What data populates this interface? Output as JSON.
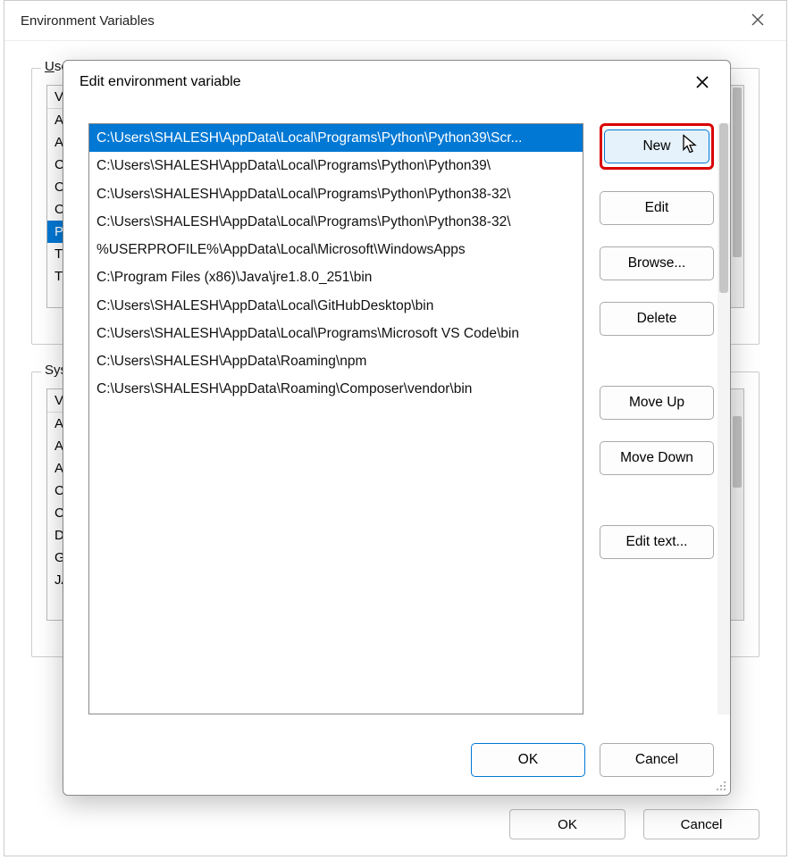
{
  "parent": {
    "title": "Environment Variables",
    "user_fieldset_label_prefix": "U",
    "user_fieldset_label_rest": "ser",
    "user_vars_header": "Va",
    "user_vars": [
      "AW",
      "AW",
      "Ch",
      "On",
      "On",
      "Pat",
      "TE",
      "TM"
    ],
    "sys_fieldset_label": "Syste",
    "sys_vars_header": "Va",
    "sys_vars": [
      "AN",
      "AN",
      "AN",
      "Ch",
      "Co",
      "Dri",
      "GR",
      "JA"
    ],
    "ok_label": "OK",
    "cancel_label": "Cancel"
  },
  "modal": {
    "title": "Edit environment variable",
    "paths": [
      "C:\\Users\\SHALESH\\AppData\\Local\\Programs\\Python\\Python39\\Scr...",
      "C:\\Users\\SHALESH\\AppData\\Local\\Programs\\Python\\Python39\\",
      "C:\\Users\\SHALESH\\AppData\\Local\\Programs\\Python\\Python38-32\\",
      "C:\\Users\\SHALESH\\AppData\\Local\\Programs\\Python\\Python38-32\\",
      "%USERPROFILE%\\AppData\\Local\\Microsoft\\WindowsApps",
      "C:\\Program Files (x86)\\Java\\jre1.8.0_251\\bin",
      "C:\\Users\\SHALESH\\AppData\\Local\\GitHubDesktop\\bin",
      "C:\\Users\\SHALESH\\AppData\\Local\\Programs\\Microsoft VS Code\\bin",
      "C:\\Users\\SHALESH\\AppData\\Roaming\\npm",
      "C:\\Users\\SHALESH\\AppData\\Roaming\\Composer\\vendor\\bin"
    ],
    "selected_index": 0,
    "buttons": {
      "new": "New",
      "edit": "Edit",
      "browse": "Browse...",
      "delete": "Delete",
      "move_up": "Move Up",
      "move_down": "Move Down",
      "edit_text": "Edit text..."
    },
    "ok_label": "OK",
    "cancel_label": "Cancel"
  }
}
